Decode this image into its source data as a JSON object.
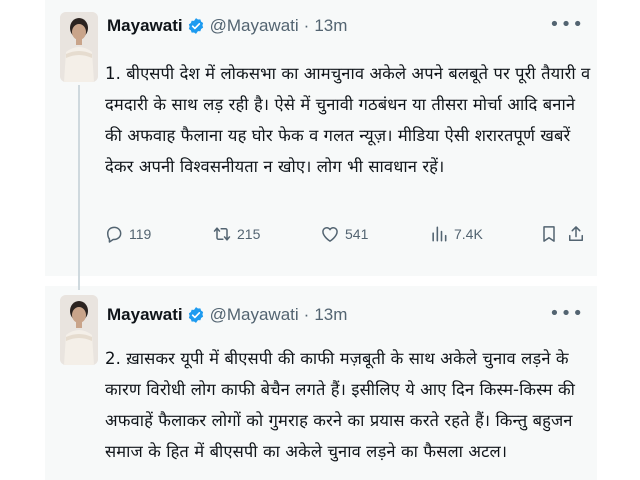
{
  "tweets": [
    {
      "author_name": "Mayawati",
      "handle": "@Mayawati",
      "separator": "·",
      "time": "13m",
      "more_icon": "more-horizontal-icon",
      "verified_icon": "verified-badge-icon",
      "text": "1. बीएसपी देश में लोकसभा का आमचुनाव अकेले अपने बलबूते पर पूरी तैयारी व दमदारी के साथ लड़ रही है। ऐसे में चुनावी गठबंधन या तीसरा मोर्चा आदि बनाने की अफवाह फैलाना यह घोर फेक व गलत न्यूज़। मीडिया ऐसी शरारतपूर्ण खबरें देकर अपनी विश्वसनीयता न खोए। लोग भी सावधान रहें।",
      "stats": {
        "replies": "119",
        "retweets": "215",
        "likes": "541",
        "views": "7.4K"
      }
    },
    {
      "author_name": "Mayawati",
      "handle": "@Mayawati",
      "separator": "·",
      "time": "13m",
      "more_icon": "more-horizontal-icon",
      "verified_icon": "verified-badge-icon",
      "text": "2. ख़ासकर यूपी में बीएसपी की काफी मज़बूती के साथ अकेले चुनाव लड़ने के कारण विरोधी लोग काफी बेचैन लगते हैं। इसीलिए ये आए दिन किस्म-किस्म की अफवाहें फैलाकर लोगों को गुमराह करने का प्रयास करते रहते हैं। किन्तु बहुजन समाज के हित में बीएसपी का अकेले चुनाव लड़ने का फैसला अटल।"
    }
  ],
  "colors": {
    "tweet_bg": "#f7f9f9",
    "text": "#0f1419",
    "secondary": "#536471",
    "verified": "#1d9bf0",
    "thread_line": "#cfd9de"
  }
}
